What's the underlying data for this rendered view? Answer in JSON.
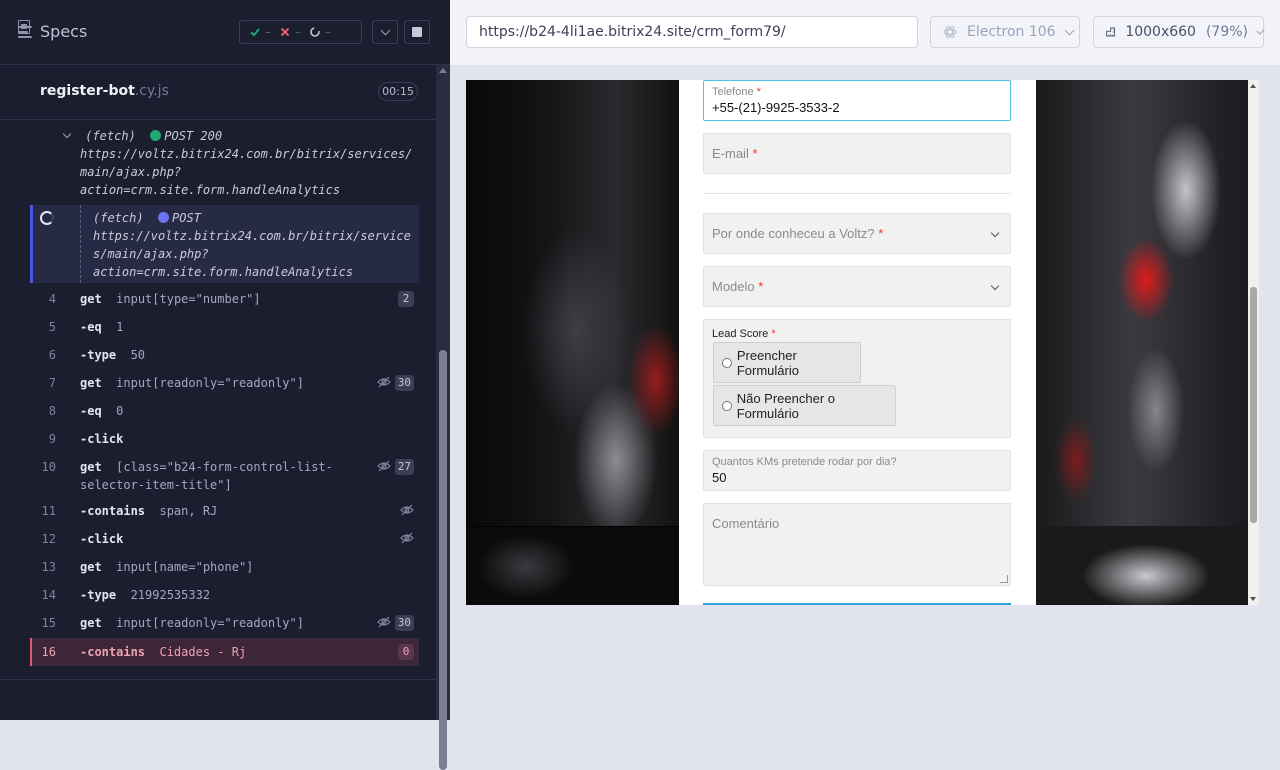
{
  "reporter": {
    "title": "Specs",
    "stats": {
      "passed": "–",
      "failed": "–",
      "pending": "–"
    },
    "spec_file": {
      "name": "register-bot",
      "ext": ".cy.js"
    },
    "duration": "00:15"
  },
  "log": {
    "fetch1": {
      "kind": "(fetch)",
      "method_status": "POST 200",
      "url_lines": [
        "https://voltz.bitrix24.com.br/bitrix/services/",
        "main/ajax.php?",
        "action=crm.site.form.handleAnalytics"
      ]
    },
    "fetch2": {
      "kind": "(fetch)",
      "method_status": "POST",
      "url_lines": [
        "https://voltz.bitrix24.com.br/bitrix/service",
        "s/main/ajax.php?",
        "action=crm.site.form.handleAnalytics"
      ]
    },
    "commands": [
      {
        "num": "4",
        "name": "get",
        "arg": "input[type=\"number\"]",
        "badge": "2"
      },
      {
        "num": "5",
        "name": "-eq",
        "arg": "1",
        "badge": ""
      },
      {
        "num": "6",
        "name": "-type",
        "arg": "50",
        "badge": ""
      },
      {
        "num": "7",
        "name": "get",
        "arg": "input[readonly=\"readonly\"]",
        "badge": "30"
      },
      {
        "num": "8",
        "name": "-eq",
        "arg": "0",
        "badge": ""
      },
      {
        "num": "9",
        "name": "-click",
        "arg": "",
        "badge": ""
      },
      {
        "num": "10",
        "name": "get",
        "arg": "[class=\"b24-form-control-list-",
        "arg2": "selector-item-title\"]",
        "badge": "27"
      },
      {
        "num": "11",
        "name": "-contains",
        "arg": "span, RJ",
        "badge": ""
      },
      {
        "num": "12",
        "name": "-click",
        "arg": "",
        "badge": ""
      },
      {
        "num": "13",
        "name": "get",
        "arg": "input[name=\"phone\"]",
        "badge": ""
      },
      {
        "num": "14",
        "name": "-type",
        "arg": "21992535332",
        "badge": ""
      },
      {
        "num": "15",
        "name": "get",
        "arg": "input[readonly=\"readonly\"]",
        "badge": "30"
      },
      {
        "num": "16",
        "name": "-contains",
        "arg": "Cidades - Rj",
        "badge": "0"
      }
    ]
  },
  "aut": {
    "url": "https://b24-4li1ae.bitrix24.site/crm_form79/",
    "browser": "Electron 106",
    "viewport": "1000x660",
    "scale": "(79%)"
  },
  "form": {
    "phone_label": "Telefone",
    "phone_value": "+55-(21)-9925-3533-2",
    "email_placeholder": "E-mail",
    "source_placeholder": "Por onde conheceu a Voltz?",
    "model_placeholder": "Modelo",
    "lead_label": "Lead Score",
    "lead_option_1": "Preencher Formulário",
    "lead_option_2": "Não Preencher o Formulário",
    "km_label": "Quantos KMs pretende rodar por dia?",
    "km_value": "50",
    "comment_placeholder": "Comentário",
    "required_mark": "*"
  },
  "colors": {
    "accent": "#4956e3",
    "failed": "#e45770",
    "passed": "#1fa971",
    "form_focus": "#51c1e6"
  }
}
